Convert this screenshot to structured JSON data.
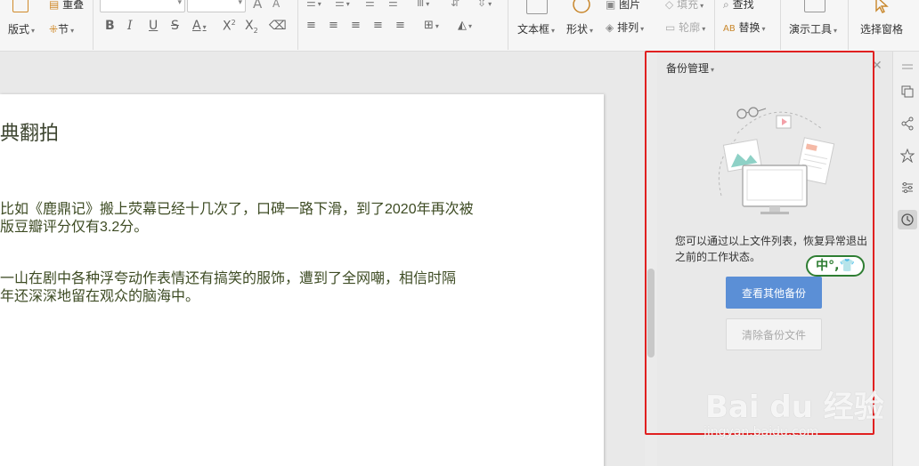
{
  "ribbon": {
    "layout_label": "版式",
    "reorder_label": "重叠",
    "section_label": "节",
    "textbox_label": "文本框",
    "shape_label": "形状",
    "picture_label": "图片",
    "arrange_label": "排列",
    "fill_label": "填充",
    "outline_label": "轮廓",
    "find_label": "查找",
    "replace_label": "替换",
    "present_tools_label": "演示工具",
    "select_pane_label": "选择窗格"
  },
  "document": {
    "title": "典翻拍",
    "para1_line1": "比如《鹿鼎记》搬上荧幕已经十几次了，口碑一路下滑，到了2020年再次被",
    "para1_line2": "版豆瓣评分仅有3.2分。",
    "para2_line1": "一山在剧中各种浮夸动作表情还有搞笑的服饰，遭到了全网嘲，相信时隔",
    "para2_line2": "年还深深地留在观众的脑海中。"
  },
  "pane": {
    "title": "备份管理",
    "description": "您可以通过以上文件列表，恢复异常退出之前的工作状态。",
    "view_other_button": "查看其他备份",
    "clear_button": "清除备份文件"
  },
  "ime": {
    "text": "中°,👕"
  },
  "watermark": {
    "brand": "Bai du 经验",
    "url": "jingyan.baidu.com"
  }
}
